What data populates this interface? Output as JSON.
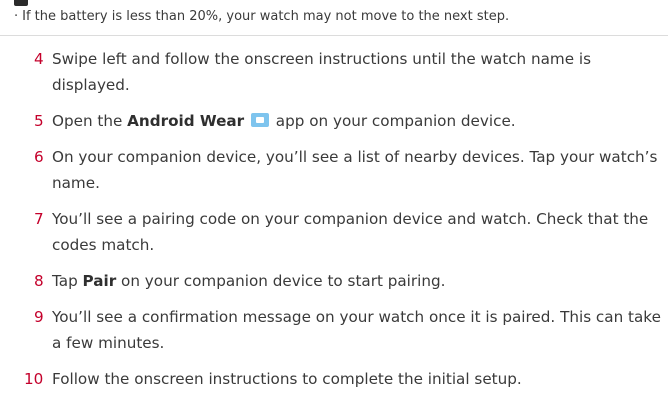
{
  "note": {
    "bullet": "·",
    "text": "If the battery is less than 20%, your watch may not move to the next step."
  },
  "steps": [
    {
      "num": "4",
      "text": "Swipe left and follow the onscreen instructions until the watch name is displayed."
    },
    {
      "num": "5",
      "pre": "Open the ",
      "bold": "Android Wear",
      "post": " app on your companion device.",
      "icon": "android-wear-app-icon"
    },
    {
      "num": "6",
      "text": "On your companion device, you’ll see a list of nearby devices. Tap your watch’s name."
    },
    {
      "num": "7",
      "text": "You’ll see a pairing code on your companion device and watch. Check that the codes match."
    },
    {
      "num": "8",
      "pre": "Tap ",
      "bold": "Pair",
      "post": " on your companion device to start pairing."
    },
    {
      "num": "9",
      "text": "You’ll see a confirmation message on your watch once it is paired. This can take a few minutes."
    },
    {
      "num": "10",
      "text": "Follow the onscreen instructions to complete the initial setup."
    }
  ],
  "colors": {
    "step_number": "#c4002b",
    "body_text": "#3a3a3a",
    "icon": "#7ec4ee"
  }
}
